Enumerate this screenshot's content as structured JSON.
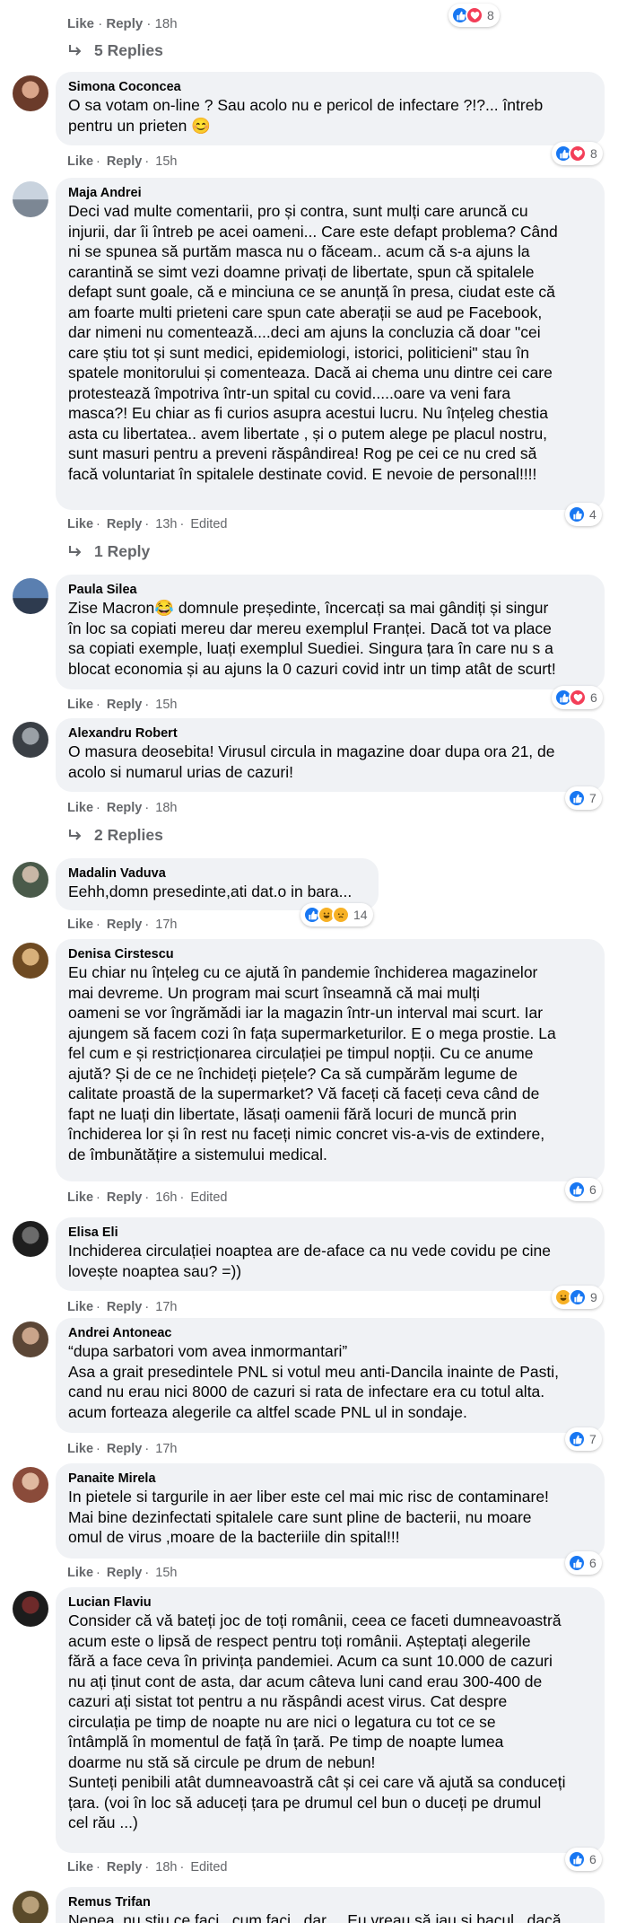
{
  "top": {
    "actions": {
      "like": "Like",
      "reply": "Reply",
      "time": "18h"
    },
    "reactions": {
      "count": "8"
    },
    "replies": "5 Replies"
  },
  "comments": [
    {
      "author": "Simona Coconcea",
      "text": "O sa votam on-line ? Sau acolo nu e pericol de infectare ?!?... întreb\npentru un prieten 😊",
      "actions": {
        "like": "Like",
        "reply": "Reply",
        "time": "15h"
      },
      "reactions": {
        "count": "8"
      }
    },
    {
      "author": "Maja Andrei",
      "text": "Deci vad multe comentarii, pro și contra, sunt mulți care aruncă cu\ninjurii, dar îi întreb pe acei oameni... Care este defapt problema? Când\nni se spunea să purtăm masca nu o făceam.. acum că s-a ajuns la\ncarantină se simt vezi doamne privați de libertate, spun că spitalele\ndefapt sunt goale, că e minciuna ce se anunță în presa, ciudat este că\nam foarte multi prieteni care spun cate aberații se aud pe Facebook,\ndar nimeni nu comentează....deci am ajuns la concluzia că doar \"cei\ncare știu tot și sunt medici, epidemiologi, istorici, politicieni\" stau în\nspatele monitorului și comenteaza. Dacă ai chema unu dintre cei care\nprotestează împotriva într-un spital cu covid.....oare va veni fara\nmasca?! Eu chiar as fi curios asupra acestui lucru. Nu înțeleg chestia\nasta cu libertatea.. avem libertate , și o putem alege pe placul nostru,\nsunt masuri pentru a preveni răspândirea! Rog pe cei ce nu cred să\nfacă voluntariat în spitalele destinate covid. E nevoie de personal!!!!",
      "actions": {
        "like": "Like",
        "reply": "Reply",
        "time": "13h",
        "edited": "Edited"
      },
      "reactions": {
        "count": "4"
      },
      "replies": "1 Reply"
    },
    {
      "author": "Paula Silea",
      "text": "Zise Macron😂 domnule președinte, încercați sa mai gândiți și singur\nîn loc sa copiati mereu dar mereu exemplul Franței. Dacă tot va place\nsa copiati exemple, luați exemplul Suediei. Singura țara în care nu s a\nblocat economia și au ajuns la 0 cazuri covid intr un timp atât de scurt!",
      "actions": {
        "like": "Like",
        "reply": "Reply",
        "time": "15h"
      },
      "reactions": {
        "count": "6"
      }
    },
    {
      "author": "Alexandru Robert",
      "text": "O masura deosebita! Virusul circula in magazine doar dupa ora 21, de\nacolo si numarul urias de cazuri!",
      "actions": {
        "like": "Like",
        "reply": "Reply",
        "time": "18h"
      },
      "reactions": {
        "count": "7"
      },
      "replies": "2 Replies"
    },
    {
      "author": "Madalin Vaduva",
      "text": "Eehh,domn presedinte,ati dat.o in bara...",
      "actions": {
        "like": "Like",
        "reply": "Reply",
        "time": "17h"
      },
      "reactions": {
        "count": "14"
      }
    },
    {
      "author": "Denisa Cirstescu",
      "text": "Eu chiar nu înțeleg cu ce ajută în pandemie închiderea magazinelor\nmai devreme. Un program mai scurt înseamnă că mai mulți\noameni se vor îngrămădi iar la magazin într-un interval mai scurt. Iar\najungem să facem cozi în fața supermarketurilor. E o mega prostie. La\nfel cum e și restricționarea circulației pe timpul nopții. Cu ce anume\najută? Și de ce ne închideți piețele? Ca să cumpărăm legume de\ncalitate proastă de la supermarket? Vă faceți că faceți ceva când de\nfapt ne luați din libertate, lăsați oamenii fără locuri de muncă prin\nînchiderea lor și în rest nu faceți nimic concret vis-a-vis de extindere,\nde îmbunătățire a sistemului medical.",
      "actions": {
        "like": "Like",
        "reply": "Reply",
        "time": "16h",
        "edited": "Edited"
      },
      "reactions": {
        "count": "6"
      }
    },
    {
      "author": "Elisa Eli",
      "text": "Inchiderea circulației noaptea are de-aface ca nu vede covidu pe cine\nlovește noaptea sau? =))",
      "actions": {
        "like": "Like",
        "reply": "Reply",
        "time": "17h"
      },
      "reactions": {
        "count": "9"
      }
    },
    {
      "author": "Andrei Antoneac",
      "text": "“dupa sarbatori vom avea inmormantari”\nAsa a grait presedintele PNL si votul meu anti-Dancila inainte de Pasti,\ncand nu erau nici 8000 de cazuri si rata de infectare era cu totul alta.\nacum forteaza alegerile ca altfel scade PNL ul in sondaje.",
      "actions": {
        "like": "Like",
        "reply": "Reply",
        "time": "17h"
      },
      "reactions": {
        "count": "7"
      }
    },
    {
      "author": "Panaite Mirela",
      "text": "In pietele si targurile in aer liber este cel mai mic risc de contaminare!\nMai bine dezinfectati spitalele care sunt pline de bacterii, nu moare\nomul de virus ,moare de la bacteriile din spital!!!",
      "actions": {
        "like": "Like",
        "reply": "Reply",
        "time": "15h"
      },
      "reactions": {
        "count": "6"
      }
    },
    {
      "author": "Lucian Flaviu",
      "text": "Consider că vă bateți joc de toți românii, ceea ce faceti dumneavoastră\nacum este o lipsă de respect pentru toți românii. Așteptați alegerile\nfără a face ceva în privința pandemiei. Acum ca sunt 10.000 de cazuri\nnu ați ținut cont de asta, dar acum câteva luni cand erau 300-400 de\ncazuri ați sistat tot pentru a nu răspândi acest virus. Cat despre\ncirculația pe timp de noapte nu are nici o legatura cu tot ce se\nîntâmplă în momentul de față în țară. Pe timp de noapte lumea\ndoarme nu stă să circule pe drum de nebun!\nSunteți penibili atât dumneavoastră cât și cei care vă ajută sa conduceți\nțara. (voi în loc să aduceți țara pe drumul cel bun o duceți pe drumul\ncel rău ...)",
      "actions": {
        "like": "Like",
        "reply": "Reply",
        "time": "18h",
        "edited": "Edited"
      },
      "reactions": {
        "count": "6"
      }
    },
    {
      "author": "Remus Trifan",
      "text": "Nenea, nu știu ce faci , cum faci , dar.... Eu vreau să iau și bacul , dacă"
    }
  ],
  "colors": {
    "like": "#1877f2",
    "love": "#f33e58",
    "haha": "#f7b125",
    "bubble": "#f0f2f5",
    "meta": "#65676b"
  }
}
